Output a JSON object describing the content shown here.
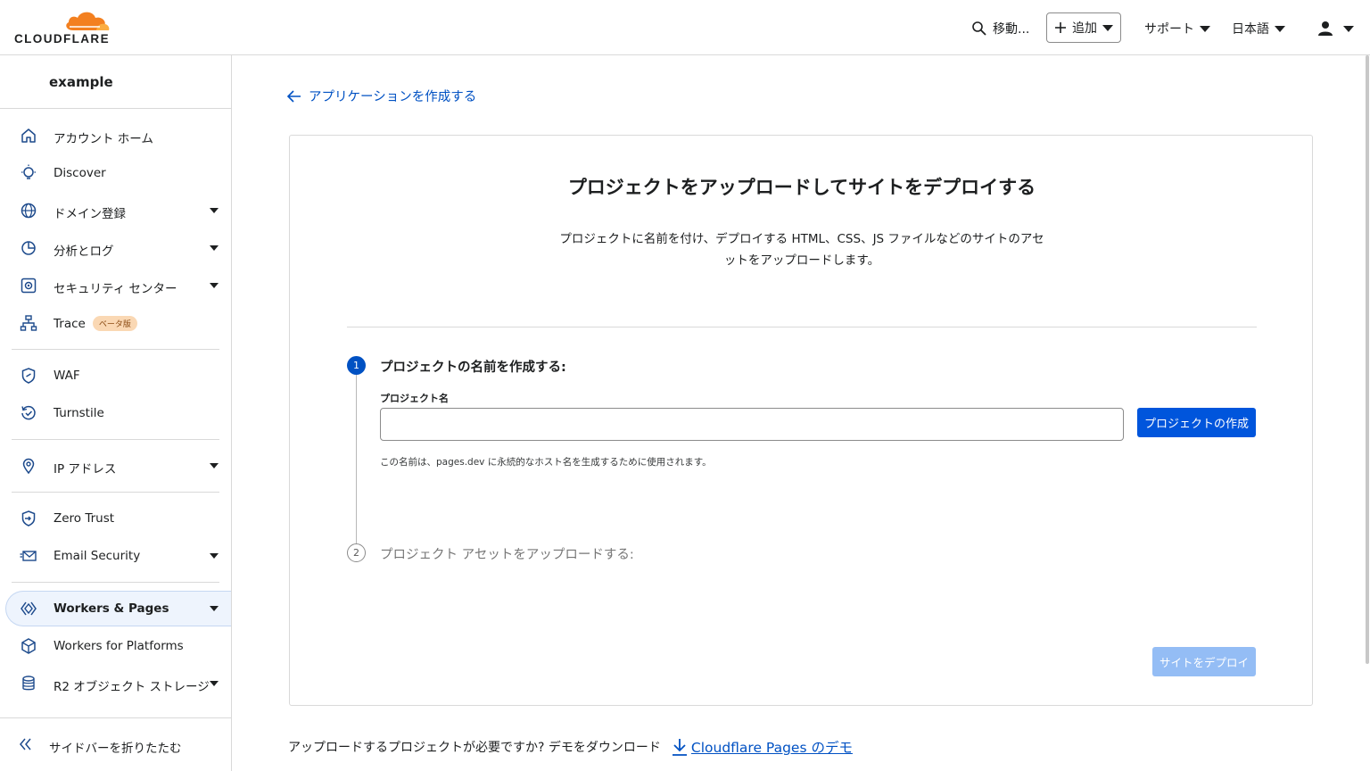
{
  "header": {
    "logo_text": "CLOUDFLARE",
    "search_label": "移動...",
    "add_label": "追加",
    "support_label": "サポート",
    "language_label": "日本語"
  },
  "sidebar": {
    "account_name": "example",
    "items": [
      {
        "label": "アカウント ホーム",
        "icon": "home-icon"
      },
      {
        "label": "Discover",
        "icon": "lightbulb-icon"
      },
      {
        "label": "ドメイン登録",
        "icon": "globe-icon"
      },
      {
        "label": "分析とログ",
        "icon": "pie-chart-icon"
      },
      {
        "label": "セキュリティ センター",
        "icon": "security-center-icon"
      },
      {
        "label": "Trace",
        "icon": "trace-icon",
        "badge": "ベータ版"
      },
      {
        "label": "WAF",
        "icon": "waf-shield-icon"
      },
      {
        "label": "Turnstile",
        "icon": "turnstile-icon"
      },
      {
        "label": "IP アドレス",
        "icon": "location-pin-icon"
      },
      {
        "label": "Zero Trust",
        "icon": "zero-trust-icon"
      },
      {
        "label": "Email Security",
        "icon": "email-icon"
      },
      {
        "label": "Workers & Pages",
        "icon": "workers-icon"
      },
      {
        "label": "Workers for Platforms",
        "icon": "cube-icon"
      },
      {
        "label": "R2 オブジェクト ストレージ",
        "icon": "database-icon"
      }
    ],
    "collapse_label": "サイドバーを折りたたむ"
  },
  "main": {
    "back_link": "アプリケーションを作成する",
    "title": "プロジェクトをアップロードしてサイトをデプロイする",
    "description": "プロジェクトに名前を付け、デプロイする HTML、CSS、JS ファイルなどのサイトのアセットをアップロードします。",
    "step1": {
      "number": "1",
      "title": "プロジェクトの名前を作成する:",
      "field_label": "プロジェクト名",
      "field_value": "",
      "button": "プロジェクトの作成",
      "help": "この名前は、pages.dev に永続的なホスト名を生成するために使用されます。"
    },
    "step2": {
      "number": "2",
      "title": "プロジェクト アセットをアップロードする:"
    },
    "deploy_button": "サイトをデプロイ",
    "footer_text": "アップロードするプロジェクトが必要ですか? デモをダウンロード",
    "demo_link": "Cloudflare Pages のデモ"
  },
  "colors": {
    "accent": "#0051c3",
    "primary_button": "#0055dc",
    "disabled_button": "#94bdf5",
    "logo_orange": "#f38020"
  }
}
